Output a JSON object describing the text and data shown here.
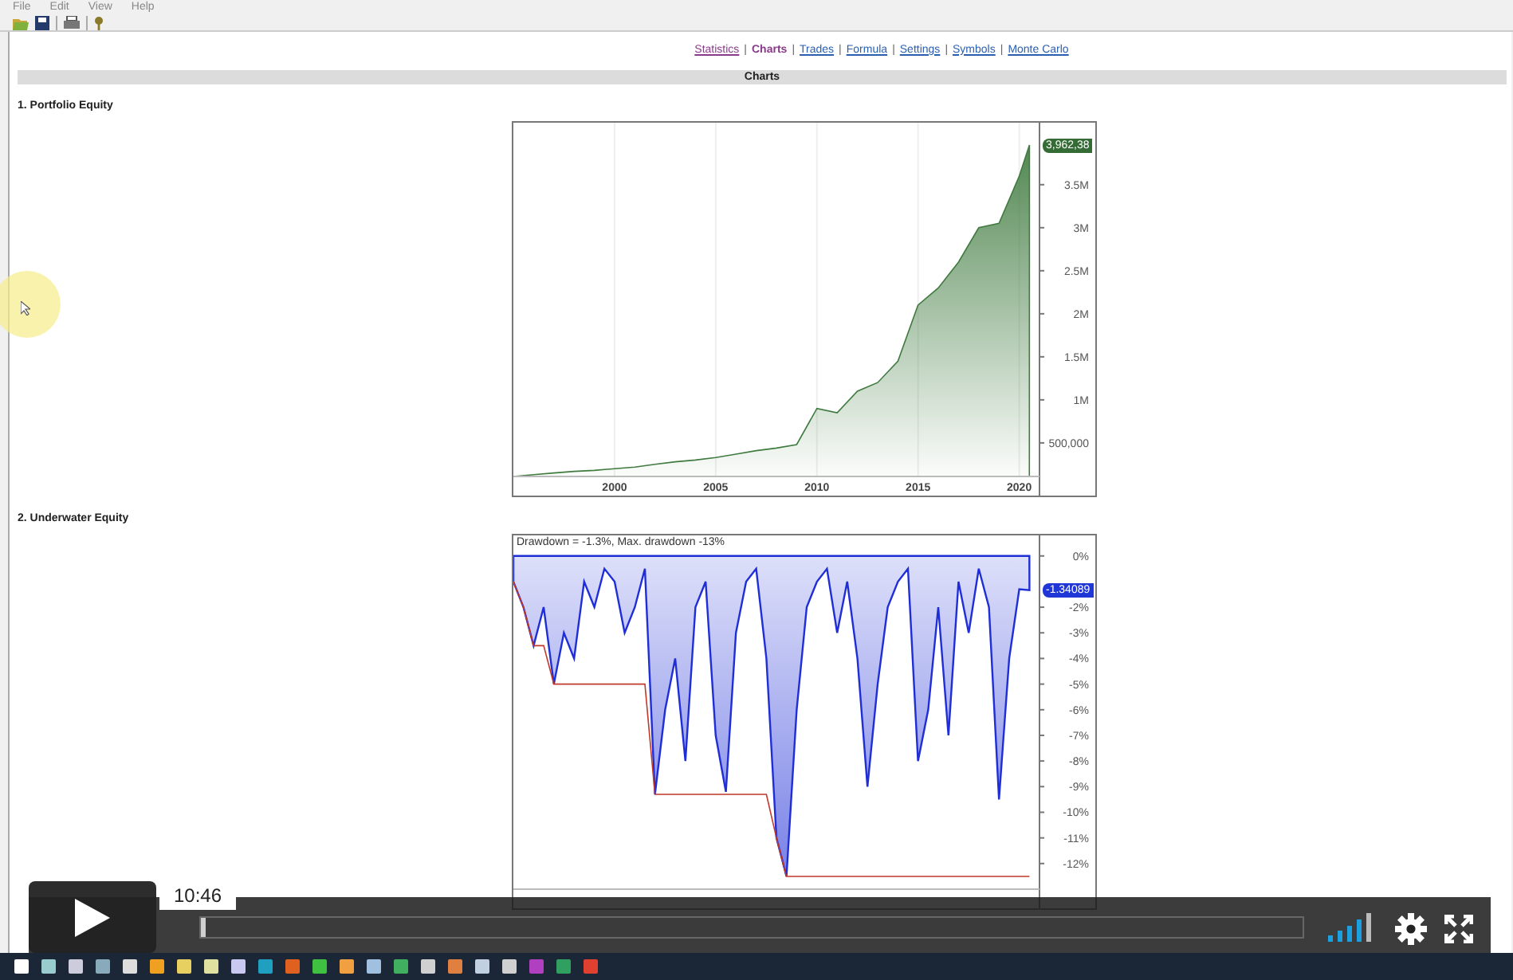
{
  "menu": [
    "File",
    "Edit",
    "View",
    "Help"
  ],
  "nav_separator": "|",
  "nav": [
    {
      "label": "Statistics",
      "selected": false,
      "visited": true
    },
    {
      "label": "Charts",
      "selected": true,
      "visited": true
    },
    {
      "label": "Trades",
      "selected": false,
      "visited": false
    },
    {
      "label": "Formula",
      "selected": false,
      "visited": false
    },
    {
      "label": "Settings",
      "selected": false,
      "visited": false
    },
    {
      "label": "Symbols",
      "selected": false,
      "visited": false
    },
    {
      "label": "Monte Carlo",
      "selected": false,
      "visited": false
    }
  ],
  "section_bar": "Charts",
  "sections": [
    {
      "heading": "1. Portfolio Equity",
      "value_label": "3,962,38",
      "chart_data": {
        "type": "area",
        "x": [
          1995,
          1996,
          1997,
          1998,
          1999,
          2000,
          2001,
          2002,
          2003,
          2004,
          2005,
          2006,
          2007,
          2008,
          2009,
          2010,
          2011,
          2012,
          2013,
          2014,
          2015,
          2016,
          2017,
          2018,
          2019,
          2020,
          2020.5
        ],
        "grid": true,
        "series": [
          {
            "color": "#3f7a3f",
            "values": [
              110000,
              130000,
              150000,
              170000,
              180000,
              200000,
              220000,
              250000,
              280000,
              300000,
              330000,
              370000,
              410000,
              440000,
              480000,
              900000,
              850000,
              1100000,
              1200000,
              1450000,
              2100000,
              2300000,
              2600000,
              3000000,
              3050000,
              3600000,
              3960000
            ]
          }
        ],
        "xlim": [
          1995,
          2021
        ],
        "ylim": [
          110000,
          4220000
        ],
        "xticks": [
          2000,
          2005,
          2010,
          2015,
          2020
        ],
        "yticks": [
          {
            "value": 500000,
            "label": "500,000"
          },
          {
            "value": 1000000,
            "label": "1M"
          },
          {
            "value": 1500000,
            "label": "1.5M"
          },
          {
            "value": 2000000,
            "label": "2M"
          },
          {
            "value": 2500000,
            "label": "2.5M"
          },
          {
            "value": 3000000,
            "label": "3M"
          },
          {
            "value": 3500000,
            "label": "3.5M"
          }
        ]
      }
    },
    {
      "heading": "2. Underwater Equity",
      "title": "Drawdown = -1.3%, Max. drawdown -13%",
      "value_label": "-1.34089",
      "chart_data": {
        "type": "area",
        "x": [
          1995,
          1995.5,
          1996,
          1996.5,
          1997,
          1997.5,
          1998,
          1998.5,
          1999,
          1999.5,
          2000,
          2000.5,
          2001,
          2001.5,
          2002,
          2002.5,
          2003,
          2003.5,
          2004,
          2004.5,
          2005,
          2005.5,
          2006,
          2006.5,
          2007,
          2007.5,
          2008,
          2008.5,
          2009,
          2009.5,
          2010,
          2010.5,
          2011,
          2011.5,
          2012,
          2012.5,
          2013,
          2013.5,
          2014,
          2014.5,
          2015,
          2015.5,
          2016,
          2016.5,
          2017,
          2017.5,
          2018,
          2018.5,
          2019,
          2019.5,
          2020,
          2020.5
        ],
        "series": [
          {
            "color": "#1f2ed6",
            "values": [
              -1,
              -2,
              -3.5,
              -2,
              -5,
              -3,
              -4,
              -1,
              -2,
              -0.5,
              -1,
              -3,
              -2,
              -0.5,
              -9.3,
              -6,
              -4,
              -8,
              -2,
              -1,
              -7,
              -9.2,
              -3,
              -1,
              -0.5,
              -4,
              -11,
              -12.5,
              -6,
              -2,
              -1,
              -0.5,
              -3,
              -1,
              -4,
              -9,
              -5,
              -2,
              -1,
              -0.5,
              -8,
              -6,
              -2,
              -7,
              -1,
              -3,
              -0.5,
              -2,
              -9.5,
              -4,
              -1.3,
              -1.34
            ]
          },
          {
            "type": "line",
            "color": "#c0392b",
            "values": [
              -1,
              -2,
              -3.5,
              -3.5,
              -5,
              -5,
              -5,
              -5,
              -5,
              -5,
              -5,
              -5,
              -5,
              -5,
              -9.3,
              -9.3,
              -9.3,
              -9.3,
              -9.3,
              -9.3,
              -9.3,
              -9.3,
              -9.3,
              -9.3,
              -9.3,
              -9.3,
              -11,
              -12.5,
              -12.5,
              -12.5,
              -12.5,
              -12.5,
              -12.5,
              -12.5,
              -12.5,
              -12.5,
              -12.5,
              -12.5,
              -12.5,
              -12.5,
              -12.5,
              -12.5,
              -12.5,
              -12.5,
              -12.5,
              -12.5,
              -12.5,
              -12.5,
              -12.5,
              -12.5,
              -12.5,
              -12.5
            ]
          }
        ],
        "xlim": [
          1995,
          2021
        ],
        "ylim": [
          -13,
          0.8
        ],
        "yticks": [
          {
            "value": 0,
            "label": "0%"
          },
          {
            "value": -2,
            "label": "-2%"
          },
          {
            "value": -3,
            "label": "-3%"
          },
          {
            "value": -4,
            "label": "-4%"
          },
          {
            "value": -5,
            "label": "-5%"
          },
          {
            "value": -6,
            "label": "-6%"
          },
          {
            "value": -7,
            "label": "-7%"
          },
          {
            "value": -8,
            "label": "-8%"
          },
          {
            "value": -9,
            "label": "-9%"
          },
          {
            "value": -10,
            "label": "-10%"
          },
          {
            "value": -11,
            "label": "-11%"
          },
          {
            "value": -12,
            "label": "-12%"
          }
        ]
      }
    }
  ],
  "player": {
    "time": "10:46",
    "level": 0.005
  }
}
